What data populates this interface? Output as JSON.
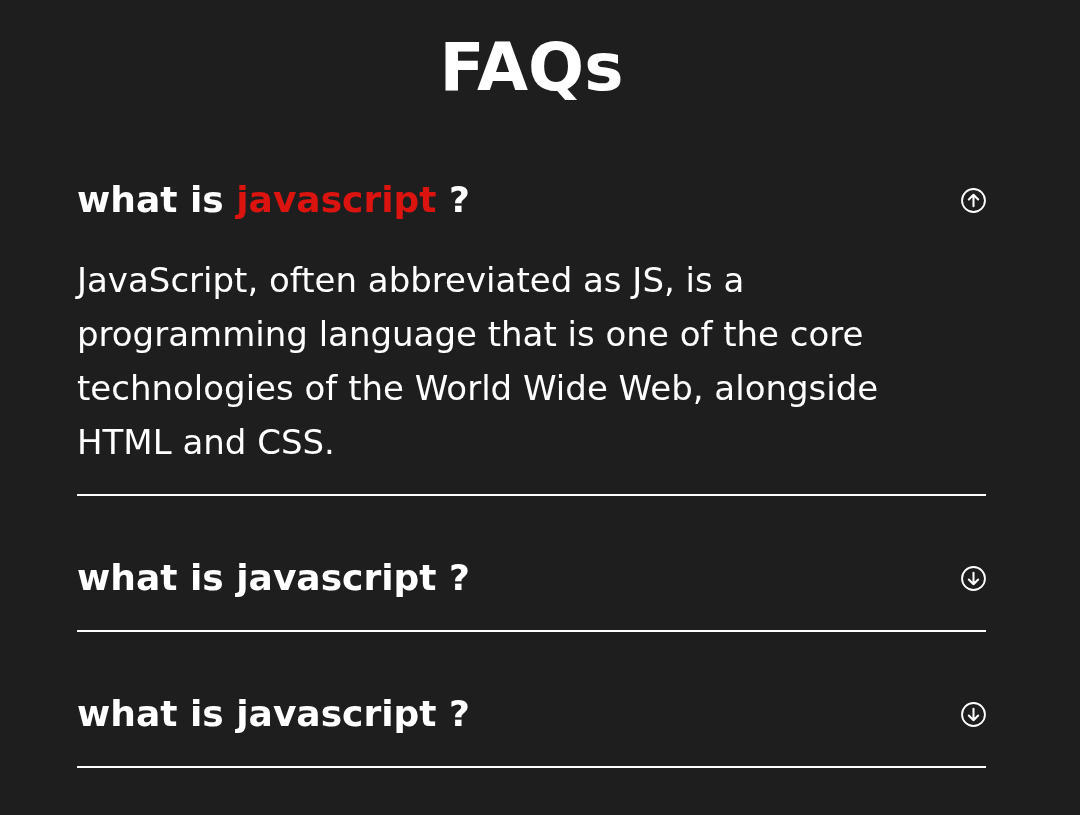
{
  "title": "FAQs",
  "faqs": [
    {
      "question_lead": "what is",
      "question_topic": "javascript",
      "question_end": "?",
      "expanded": true,
      "answer": "JavaScript, often abbreviated as JS, is a programming language that is one of the core technologies of the World Wide Web, alongside HTML and CSS."
    },
    {
      "question_lead": "what is",
      "question_topic": "javascript",
      "question_end": "?",
      "expanded": false
    },
    {
      "question_lead": "what is",
      "question_topic": "javascript",
      "question_end": "?",
      "expanded": false
    }
  ]
}
